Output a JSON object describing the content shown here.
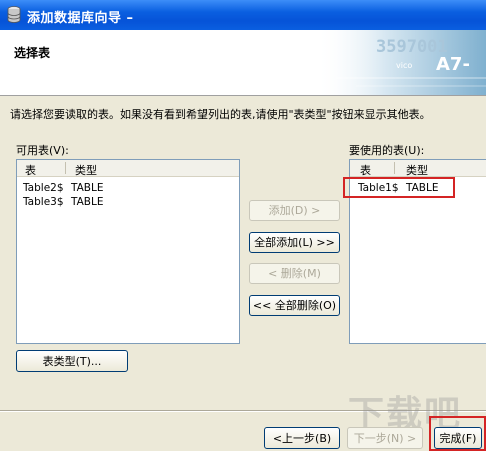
{
  "window": {
    "title": "添加数据库向导 –",
    "header_title": "选择表",
    "banner_text_1": "3597001",
    "banner_text_2": "A7-",
    "banner_text_3": "vico"
  },
  "instructions": "请选择您要读取的表。如果没有看到希望列出的表,请使用\"表类型\"按钮来显示其他表。",
  "available": {
    "label": "可用表(V):",
    "col_table": "表",
    "col_type": "类型",
    "rows": [
      {
        "name": "Table2$",
        "type": "TABLE"
      },
      {
        "name": "Table3$",
        "type": "TABLE"
      }
    ]
  },
  "selected": {
    "label": "要使用的表(U):",
    "col_table": "表",
    "col_type": "类型",
    "rows": [
      {
        "name": "Table1$",
        "type": "TABLE"
      }
    ]
  },
  "buttons": {
    "add": "添加(D) >",
    "add_all": "全部添加(L) >>",
    "remove": "< 删除(M)",
    "remove_all": "<< 全部删除(O)",
    "table_types": "表类型(T)...",
    "back": "<上一步(B)",
    "next": "下一步(N) >",
    "finish": "完成(F)"
  },
  "watermark": "下载吧",
  "colors": {
    "title_bar": "#0a5fe0",
    "highlight_box": "#d42424",
    "dialog_bg": "#ece9d8"
  }
}
